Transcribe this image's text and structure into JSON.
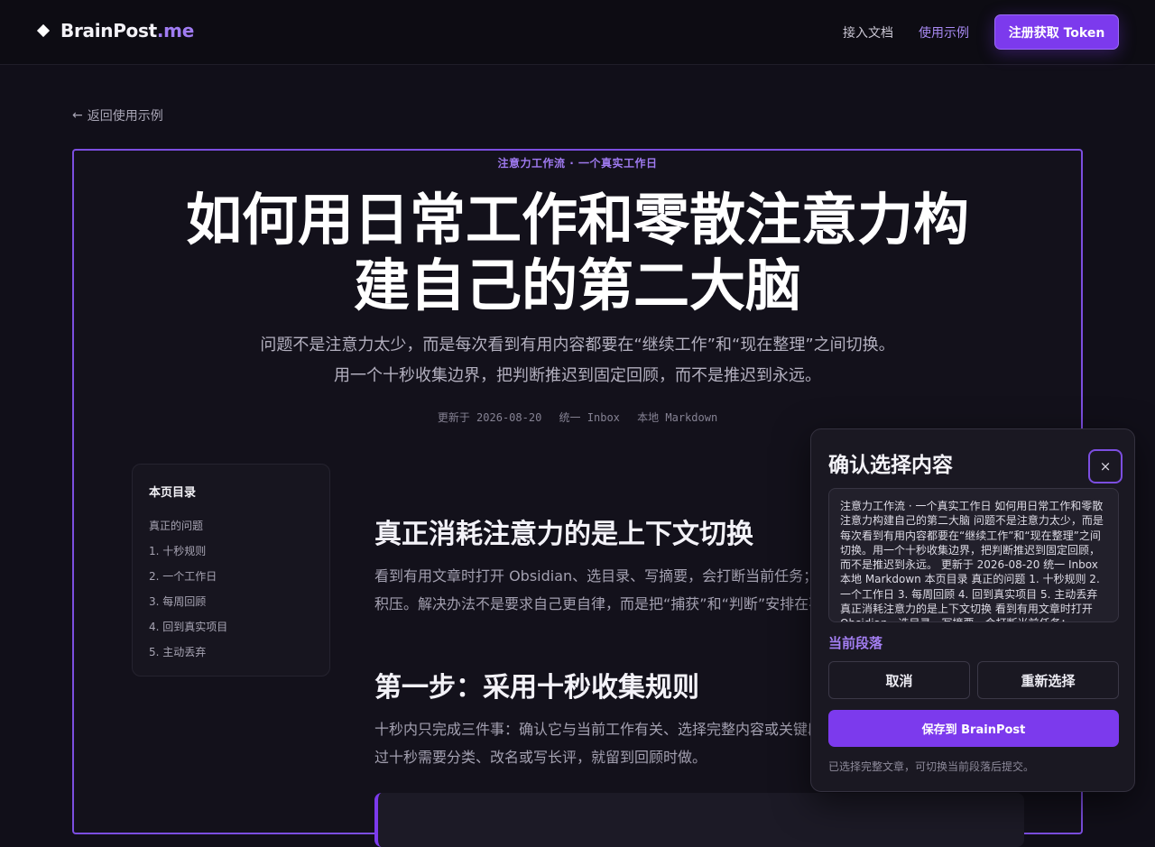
{
  "nav": {
    "brand_name": "BrainPost",
    "brand_tld": ".me",
    "docs_label": "接入文档",
    "examples_label": "使用示例",
    "cta_label": "注册获取 Token"
  },
  "back_label": "返回使用示例",
  "article": {
    "kicker": "注意力工作流 · 一个真实工作日",
    "title_line1": "如何用日常工作和零散注意力构",
    "title_line2": "建自己的第二大脑",
    "subtitle_line1": "问题不是注意力太少，而是每次看到有用内容都要在“继续工作”和“现在整理”之间切换。",
    "subtitle_line2": "用一个十秒收集边界，把判断推迟到固定回顾，而不是推迟到永远。",
    "meta": [
      "更新于 2026-08-20",
      "统一 Inbox",
      "本地 Markdown"
    ],
    "sections": [
      {
        "heading": "真正消耗注意力的是上下文切换",
        "para_line1": "看到有用文章时打开 Obsidian、选目录、写摘要，会打断当前任务；",
        "para_line2": "积压。解决办法不是要求自己更自律，而是把“捕获”和“判断”安排在不"
      },
      {
        "heading": "第一步：采用十秒收集规则",
        "para_line1": "十秒内只完成三件事：确认它与当前工作有关、选择完整内容或关键段落",
        "para_line2": "过十秒需要分类、改名或写长评，就留到回顾时做。"
      }
    ]
  },
  "toc": {
    "title": "本页目录",
    "items": [
      "真正的问题",
      "1. 十秒规则",
      "2. 一个工作日",
      "3. 每周回顾",
      "4. 回到真实项目",
      "5. 主动丢弃"
    ]
  },
  "modal": {
    "title": "确认选择内容",
    "close_label": "×",
    "selected_text": "注意力工作流 · 一个真实工作日 如何用日常工作和零散注意力构建自己的第二大脑 问题不是注意力太少，而是每次看到有用内容都要在“继续工作”和“现在整理”之间切换。用一个十秒收集边界，把判断推迟到固定回顾，而不是推迟到永远。 更新于 2026-08-20 统一 Inbox 本地 Markdown 本页目录 真正的问题 1. 十秒规则 2. 一个工作日 3. 每周回顾 4. 回到真实项目 5. 主动丢弃 真正消耗注意力的是上下文切换 看到有用文章时打开 Obsidian、选目录、写摘要，会打断当前任务；",
    "scope_label": "当前段落",
    "cancel_label": "取消",
    "reselect_label": "重新选择",
    "save_label": "保存到 BrainPost",
    "note": "已选择完整文章，可切换当前段落后提交。"
  },
  "colors": {
    "accent": "#7c3aed",
    "accent_text": "#a88af3",
    "background": "#110f19"
  }
}
